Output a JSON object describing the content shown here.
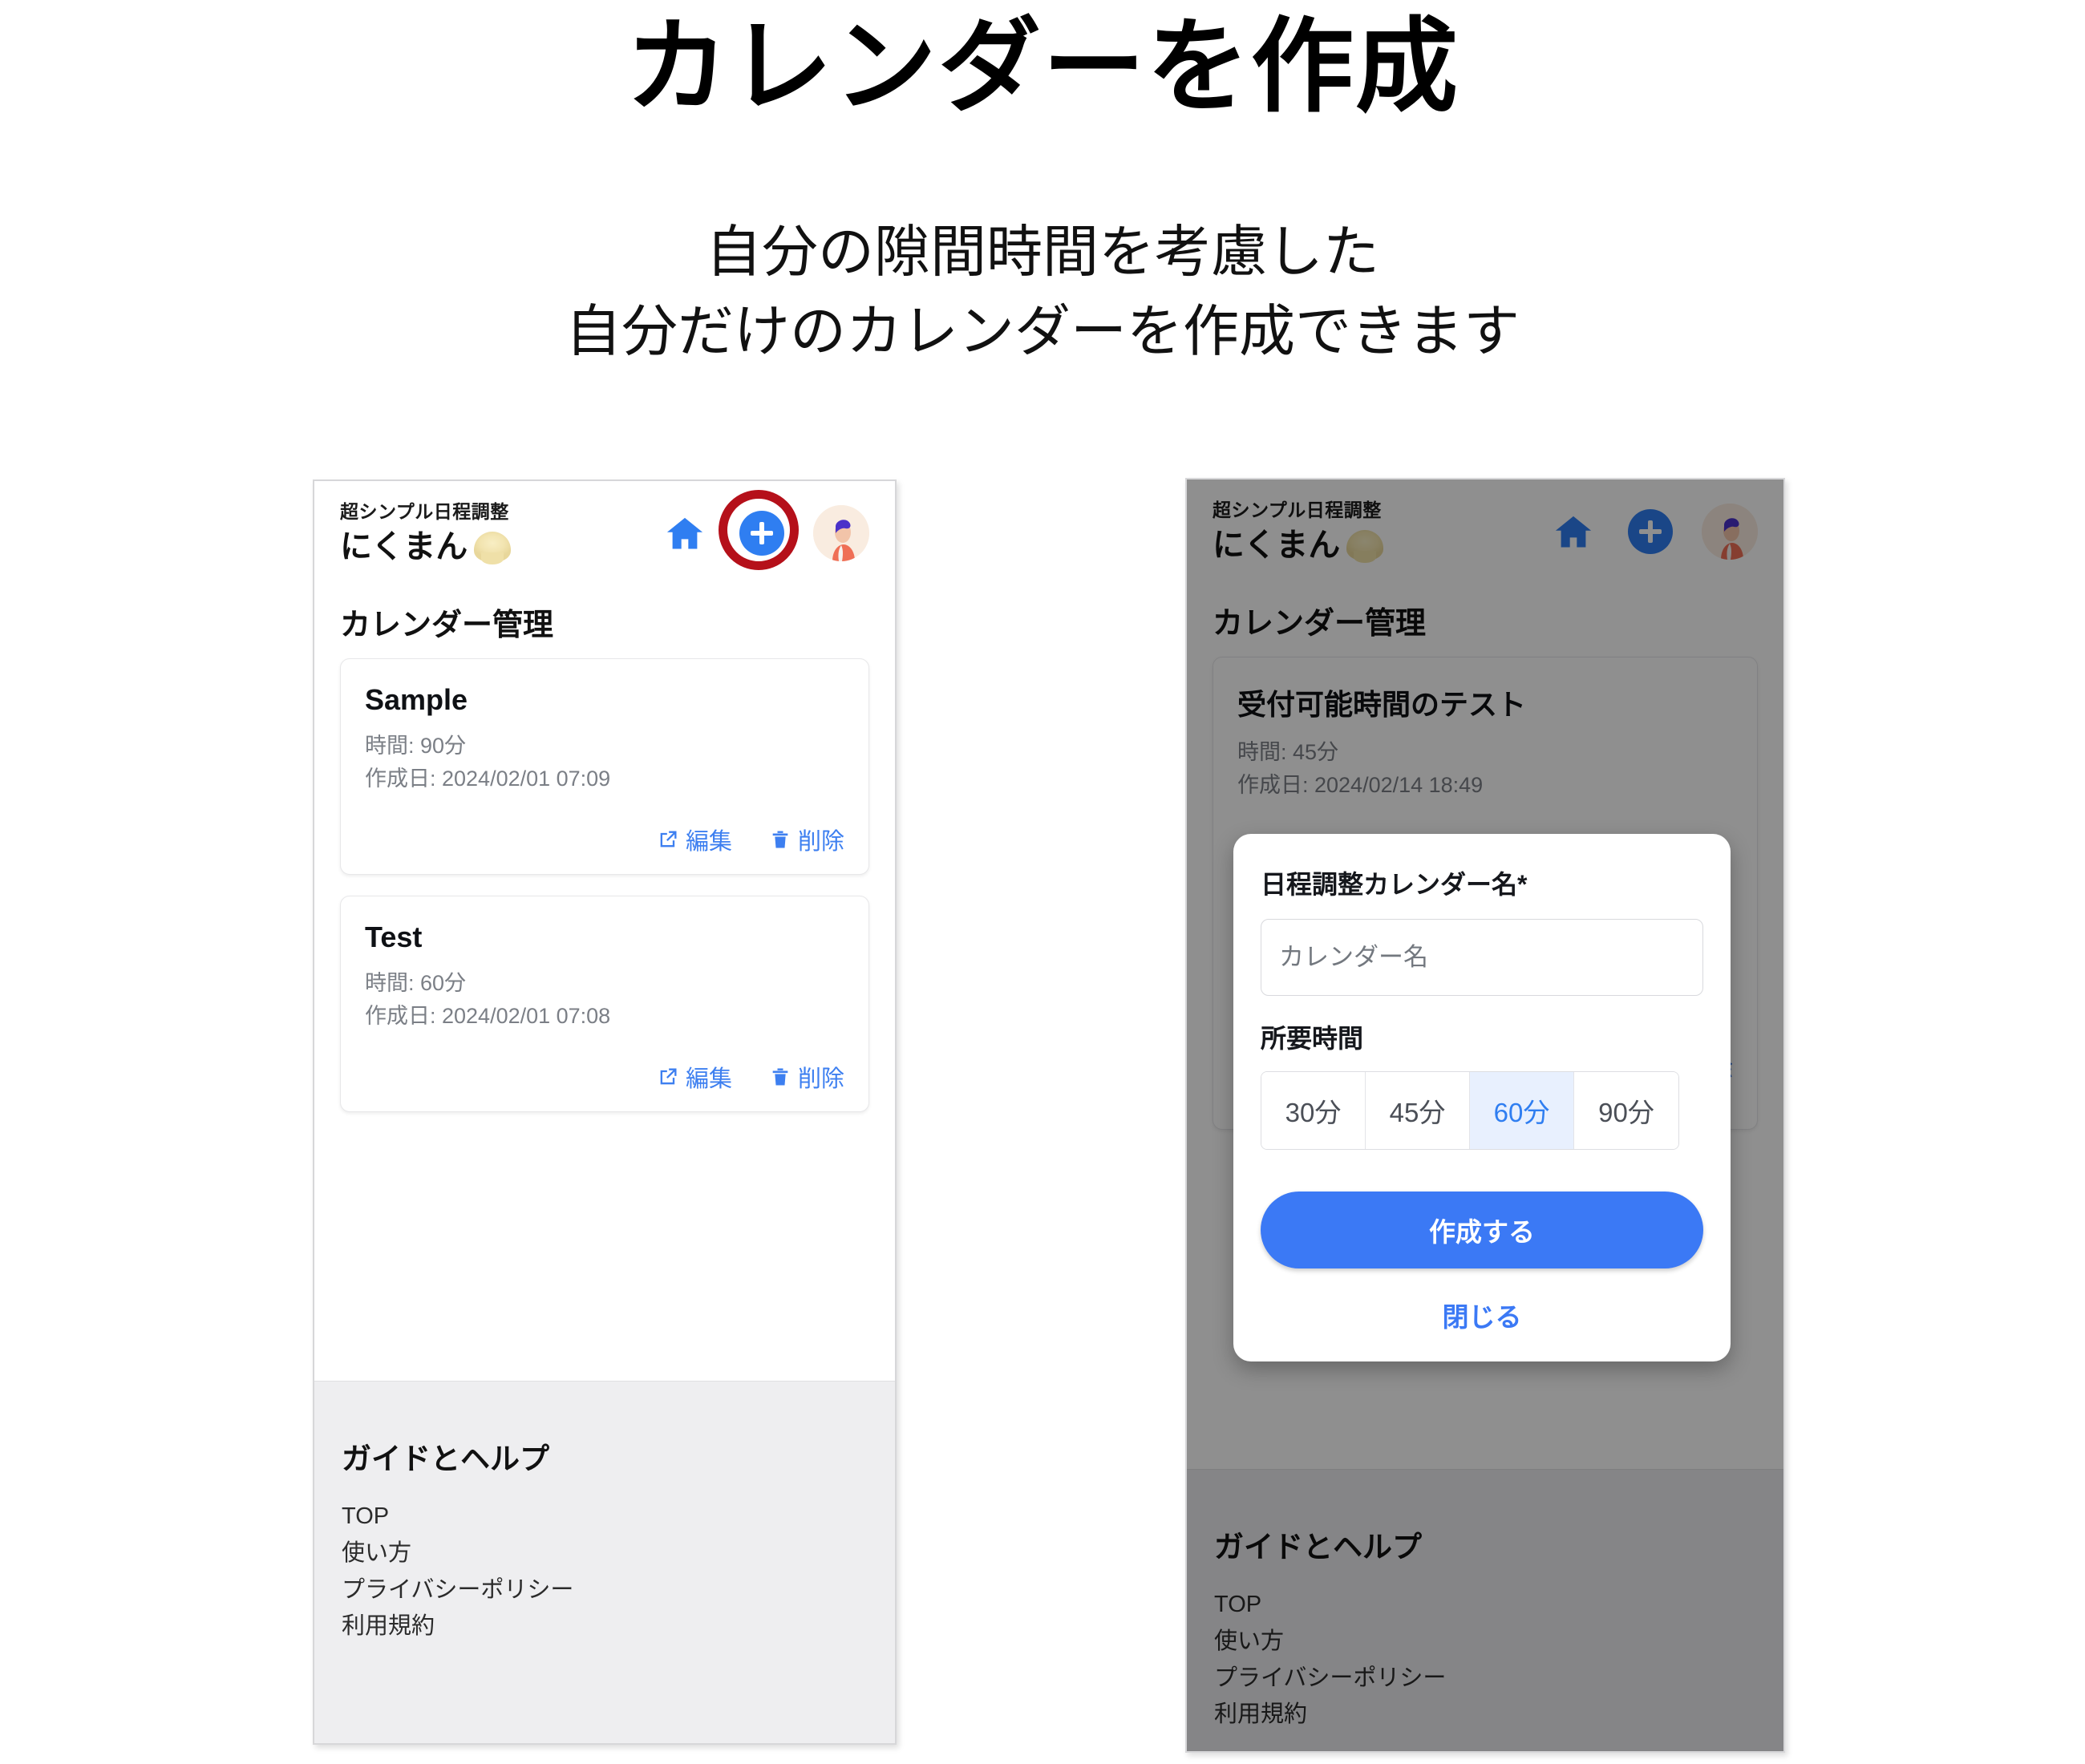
{
  "hero": {
    "title": "カレンダーを作成",
    "subtitle_line1": "自分の隙間時間を考慮した",
    "subtitle_line2": "自分だけのカレンダーを作成できます"
  },
  "colors": {
    "accent_blue": "#2f7ef1",
    "link_blue": "#3d7ff0",
    "highlight_red": "#b5101a",
    "selected_segment_bg": "#e8f0fe",
    "footer_bg": "#eeeef0",
    "scrim": "rgba(0,0,0,0.44)"
  },
  "app": {
    "brand_kicker": "超シンプル日程調整",
    "brand_name": "にくまん",
    "brand_emoji_name": "steamed-bun-emoji",
    "header_icons": [
      {
        "name": "home-icon",
        "label": "ホーム"
      },
      {
        "name": "add-calendar-icon",
        "label": "追加"
      },
      {
        "name": "avatar",
        "label": "プロフィール"
      }
    ],
    "page_title": "カレンダー管理",
    "edit_label": "編集",
    "delete_label": "削除",
    "footer": {
      "title": "ガイドとヘルプ",
      "links": [
        "TOP",
        "使い方",
        "プライバシーポリシー",
        "利用規約"
      ]
    }
  },
  "left_screen": {
    "annotation": "highlight-ring-on-add-button",
    "cards": [
      {
        "title": "Sample",
        "duration": "時間: 90分",
        "created": "作成日: 2024/02/01 07:09"
      },
      {
        "title": "Test",
        "duration": "時間: 60分",
        "created": "作成日: 2024/02/01 07:08"
      }
    ]
  },
  "right_screen": {
    "dimmed": true,
    "cards": [
      {
        "title": "受付可能時間のテスト",
        "duration": "時間: 45分",
        "created": "作成日: 2024/02/14 18:49"
      }
    ],
    "modal": {
      "name_label": "日程調整カレンダー名*",
      "name_placeholder": "カレンダー名",
      "duration_label": "所要時間",
      "duration_options": [
        "30分",
        "45分",
        "60分",
        "90分"
      ],
      "duration_selected": "60分",
      "submit_label": "作成する",
      "close_label": "閉じる"
    }
  }
}
